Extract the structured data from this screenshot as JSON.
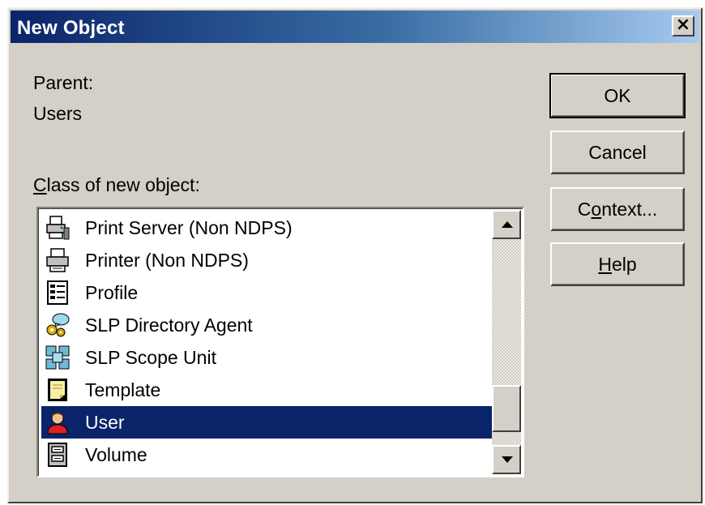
{
  "window": {
    "title": "New Object",
    "close_label": "×"
  },
  "parent": {
    "label": "Parent:",
    "value": "Users"
  },
  "class_label_prefix": "C",
  "class_label_rest": "lass of new object:",
  "buttons": {
    "ok": "OK",
    "cancel": "Cancel",
    "context_prefix": "C",
    "context_ul": "o",
    "context_rest": "ntext...",
    "help_ul": "H",
    "help_rest": "elp"
  },
  "class_list": {
    "items": [
      {
        "label": "Print Server (Non NDPS)",
        "icon": "print-server-icon"
      },
      {
        "label": "Printer (Non NDPS)",
        "icon": "printer-icon"
      },
      {
        "label": "Profile",
        "icon": "profile-icon"
      },
      {
        "label": "SLP Directory Agent",
        "icon": "slp-directory-agent-icon"
      },
      {
        "label": "SLP Scope Unit",
        "icon": "slp-scope-unit-icon"
      },
      {
        "label": "Template",
        "icon": "template-icon"
      },
      {
        "label": "User",
        "icon": "user-icon",
        "selected": true
      },
      {
        "label": "Volume",
        "icon": "volume-icon"
      }
    ],
    "selected_label": "User"
  },
  "colors": {
    "selection": "#0a246a",
    "titlebar_start": "#0a246a",
    "titlebar_end": "#a6caf0",
    "face": "#d4d0c8"
  }
}
